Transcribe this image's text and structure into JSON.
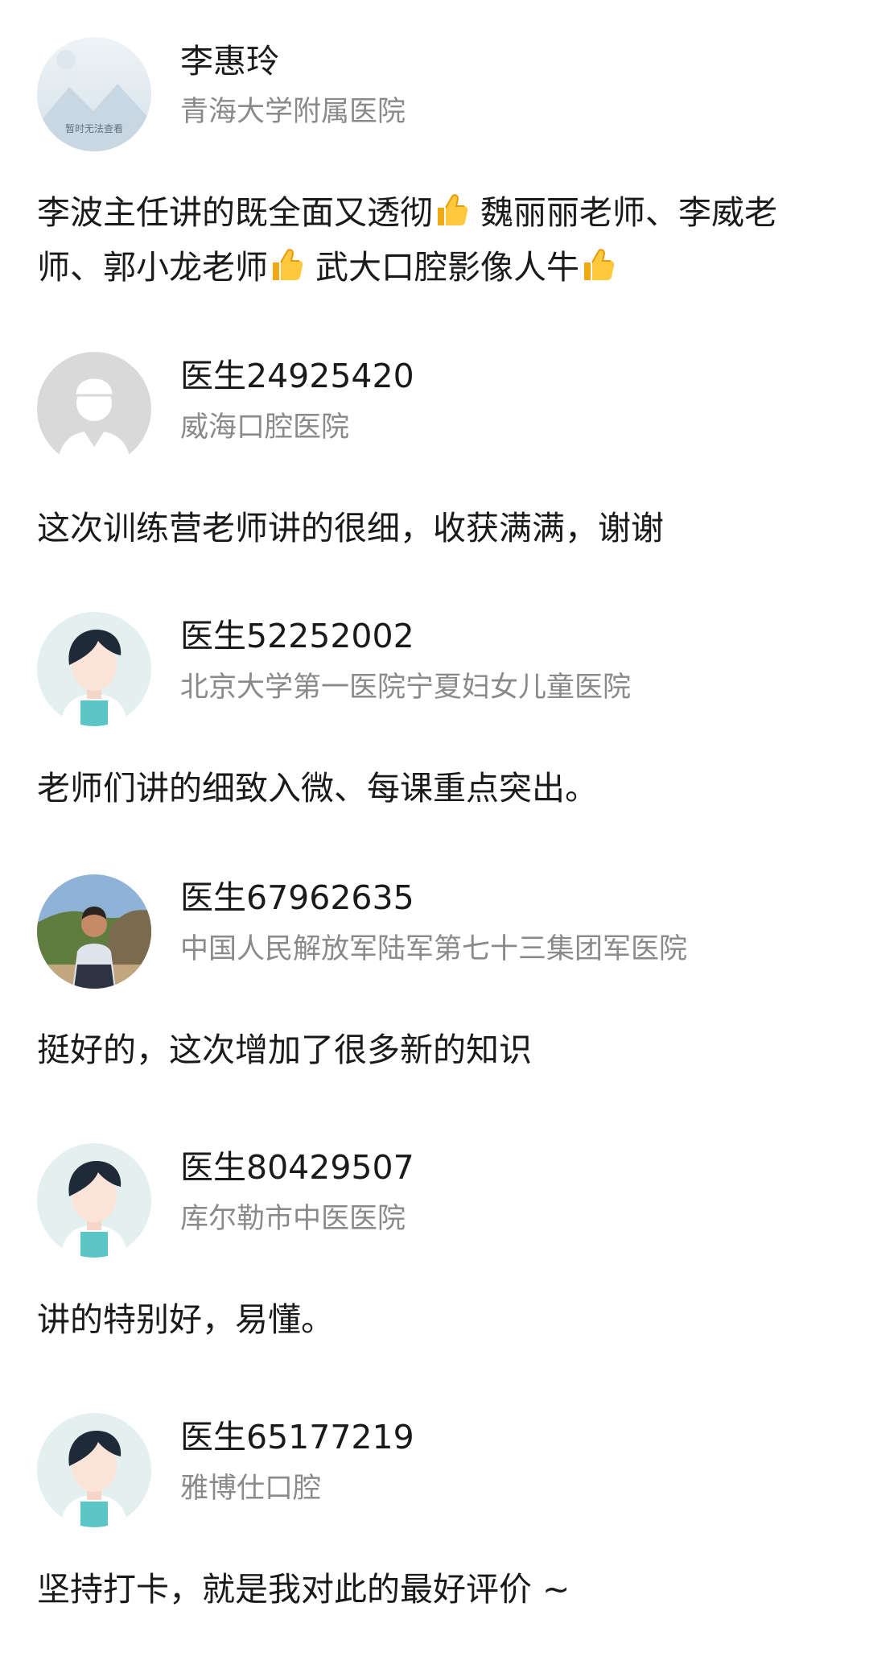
{
  "comments": [
    {
      "avatar": "placeholder-image-avatar",
      "avatar_overlay_text": "暂时无法查看",
      "name": "李惠玲",
      "org": "青海大学附属医院",
      "text_parts": [
        "李波主任讲的既全面又透彻",
        " 魏丽丽老师、李威老师、郭小龙老师",
        " 武大口腔影像人牛",
        ""
      ]
    },
    {
      "avatar": "default-doctor-gray-avatar",
      "name": "医生24925420",
      "org": "威海口腔医院",
      "text": "这次训练营老师讲的很细，收获满满，谢谢"
    },
    {
      "avatar": "cartoon-doctor-avatar",
      "name": "医生52252002",
      "org": "北京大学第一医院宁夏妇女儿童医院",
      "text": "老师们讲的细致入微、每课重点突出。"
    },
    {
      "avatar": "photo-avatar",
      "name": "医生67962635",
      "org": "中国人民解放军陆军第七十三集团军医院",
      "text": "挺好的，这次增加了很多新的知识"
    },
    {
      "avatar": "cartoon-doctor-avatar",
      "name": "医生80429507",
      "org": "库尔勒市中医医院",
      "text": "讲的特别好，易懂。"
    },
    {
      "avatar": "cartoon-doctor-avatar",
      "name": "医生65177219",
      "org": "雅博仕口腔",
      "text": "坚持打卡，就是我对此的最好评价 ~"
    }
  ],
  "emoji": "thumbs-up-icon",
  "colors": {
    "name": "#1a1a1a",
    "org": "#8a8a8a",
    "avatar_teal": "#5cc6c6",
    "avatar_bg": "#e4eff0"
  }
}
